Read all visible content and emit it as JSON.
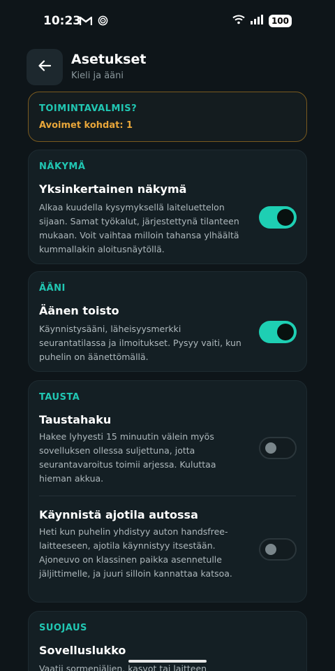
{
  "status": {
    "time": "10:23",
    "battery": "100",
    "icons": [
      "gmail-icon",
      "app-notification-icon",
      "wifi-icon",
      "signal-icon",
      "battery-icon"
    ]
  },
  "header": {
    "title": "Asetukset",
    "subtitle": "Kieli ja ääni"
  },
  "ready": {
    "label": "TOIMINTAVALMIS?",
    "open_items": "Avoimet kohdat: 1"
  },
  "view": {
    "section": "NÄKYMÄ",
    "title": "Yksinkertainen näkymä",
    "desc": "Alkaa kuudella kysymyksellä laiteluettelon sijaan. Samat työkalut, järjestettynä tilanteen mukaan. Voit vaihtaa milloin tahansa ylhäältä kummallakin aloitusnäytöllä.",
    "enabled": true
  },
  "sound": {
    "section": "ÄÄNI",
    "title": "Äänen toisto",
    "desc": "Käynnistysääni, läheisyysmerkki seurantatilassa ja ilmoitukset. Pysyy vaiti, kun puhelin on äänettömällä.",
    "enabled": true
  },
  "background": {
    "section": "TAUSTA",
    "scan": {
      "title": "Taustahaku",
      "desc": "Hakee lyhyesti 15 minuutin välein myös sovelluksen ollessa suljettuna, jotta seurantavaroitus toimii arjessa. Kuluttaa hieman akkua.",
      "enabled": false
    },
    "drive": {
      "title": "Käynnistä ajotila autossa",
      "desc": "Heti kun puhelin yhdistyy auton handsfree-laitteeseen, ajotila käynnistyy itsestään. Ajoneuvo on klassinen paikka asennetulle jäljittimelle, ja juuri silloin kannattaa katsoa.",
      "enabled": false
    }
  },
  "security": {
    "section": "SUOJAUS",
    "title": "Sovelluslukko",
    "desc": "Vaatii sormenjälien, kasvot tai laitteen"
  },
  "colors": {
    "accent": "#21c7b3",
    "toggle_on": "#1ecfb3",
    "warning": "#e8a63a",
    "background": "#0e1519",
    "card": "#141f24"
  }
}
